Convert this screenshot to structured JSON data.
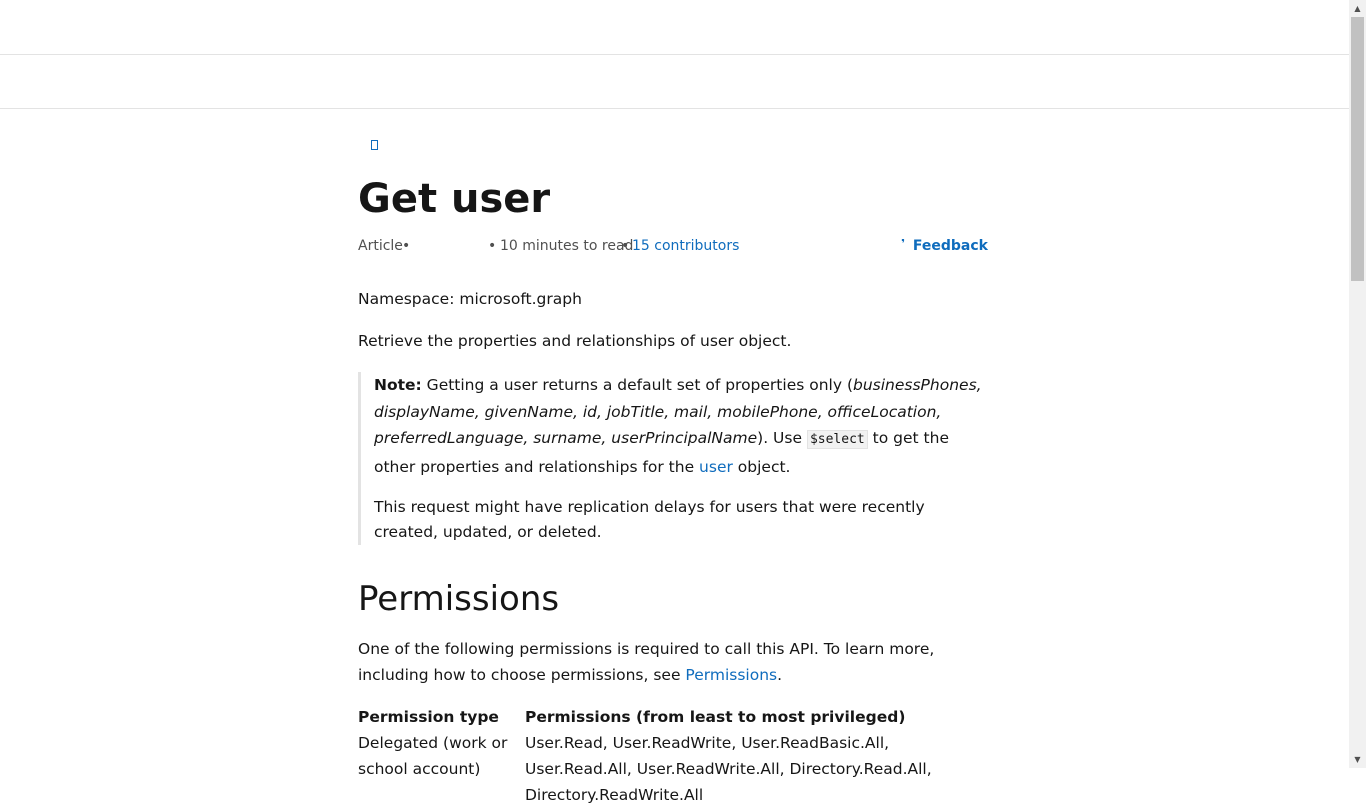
{
  "page": {
    "edit_icon": "edit-icon",
    "title": "Get user",
    "meta": {
      "type": "Article",
      "sep1": "•",
      "sep2": "•",
      "read_time": "10 minutes to read",
      "sep3": "•",
      "contributors": "15 contributors"
    },
    "feedback_label": "Feedback",
    "feedback_icon": "feedback-icon"
  },
  "body": {
    "namespace": "Namespace: microsoft.graph",
    "description": "Retrieve the properties and relationships of user object.",
    "note": {
      "label": "Note:",
      "text1": " Getting a user returns a default set of properties only (",
      "italic_props_line1": "businessPhones,",
      "italic_props_line2": "displayName, givenName, id, jobTitle, mail, mobilePhone, officeLocation,",
      "italic_props_line3": "preferredLanguage, surname, userPrincipalName",
      "text2": "). Use ",
      "code": "$select",
      "text3": " to get the other properties and relationships for the ",
      "user_link": "user",
      "text4": " object.",
      "replication": "This request might have replication delays for users that were recently created, updated, or deleted."
    },
    "permissions_heading": "Permissions",
    "permissions_intro_1": "One of the following permissions is required to call this API. To learn more, including how to choose permissions, see ",
    "permissions_link": "Permissions",
    "permissions_intro_2": ".",
    "table": {
      "headers": [
        "Permission type",
        "Permissions (from least to most privileged)"
      ],
      "rows": [
        [
          "Delegated (work or school account)",
          "User.Read, User.ReadWrite, User.ReadBasic.All, User.Read.All, User.ReadWrite.All, Directory.Read.All, Directory.ReadWrite.All"
        ]
      ]
    }
  }
}
